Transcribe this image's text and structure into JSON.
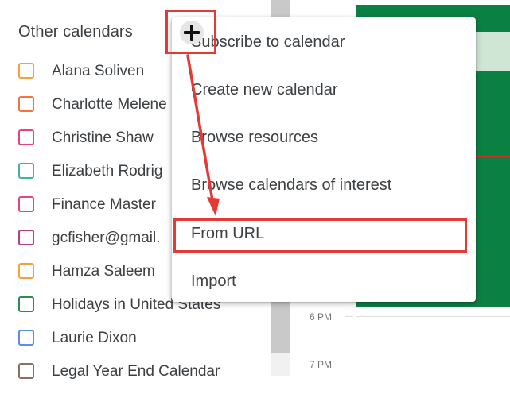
{
  "sidebar": {
    "title": "Other calendars",
    "calendars": [
      {
        "label": "Alana Soliven",
        "color": "#f6a13a"
      },
      {
        "label": "Charlotte Melene",
        "color": "#f4763d"
      },
      {
        "label": "Christine Shaw",
        "color": "#e9437a"
      },
      {
        "label": "Elizabeth Rodrig",
        "color": "#3fb3a4"
      },
      {
        "label": "Finance Master",
        "color": "#e6457d"
      },
      {
        "label": "gcfisher@gmail.",
        "color": "#b93f83"
      },
      {
        "label": "Hamza Saleem",
        "color": "#f6a13a"
      },
      {
        "label": "Holidays in United States",
        "color": "#2e8b57"
      },
      {
        "label": "Laurie Dixon",
        "color": "#5b8def"
      },
      {
        "label": "Legal Year End Calendar",
        "color": "#8d6e63"
      }
    ]
  },
  "add_button": {
    "icon": "plus-icon"
  },
  "menu": {
    "items": [
      {
        "label": "Subscribe to calendar"
      },
      {
        "label": "Create new calendar"
      },
      {
        "label": "Browse resources"
      },
      {
        "label": "Browse calendars of interest"
      },
      {
        "label": "From URL"
      },
      {
        "label": "Import"
      }
    ]
  },
  "grid": {
    "times": [
      "6 PM",
      "7 PM"
    ],
    "event_color": "#0b8043",
    "now_line_color": "#d93025"
  },
  "annotation": {
    "color": "#e53935"
  }
}
